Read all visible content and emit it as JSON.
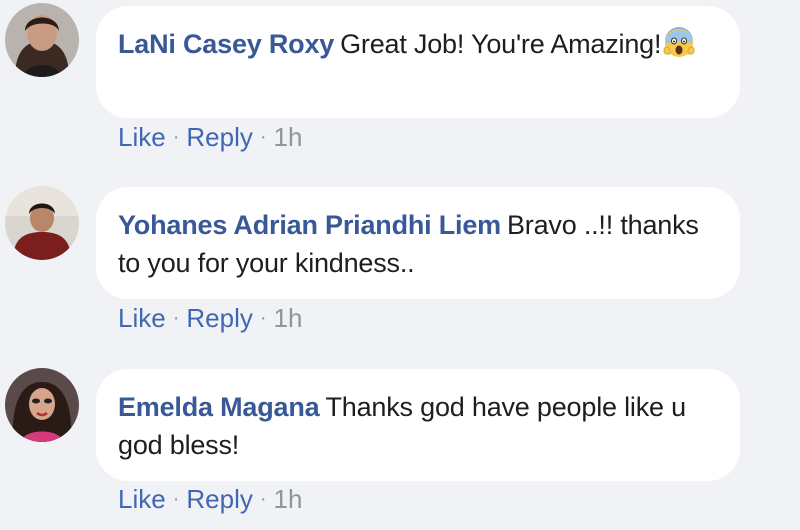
{
  "comments": [
    {
      "author": "LaNi Casey Roxy",
      "text": "Great Job! You're Amazing!",
      "emoji": "face-screaming-in-fear",
      "like_label": "Like",
      "reply_label": "Reply",
      "time": "1h"
    },
    {
      "author": "Yohanes Adrian Priandhi Liem",
      "text": "Bravo ..!! thanks to you for your kindness..",
      "like_label": "Like",
      "reply_label": "Reply",
      "time": "1h"
    },
    {
      "author": "Emelda Magana",
      "text": "Thanks god have people like u god bless!",
      "like_label": "Like",
      "reply_label": "Reply",
      "time": "1h"
    }
  ],
  "colors": {
    "background": "#f0f2f5",
    "bubble": "#ffffff",
    "author": "#385898",
    "link": "#4267b2",
    "meta": "#90949c"
  }
}
